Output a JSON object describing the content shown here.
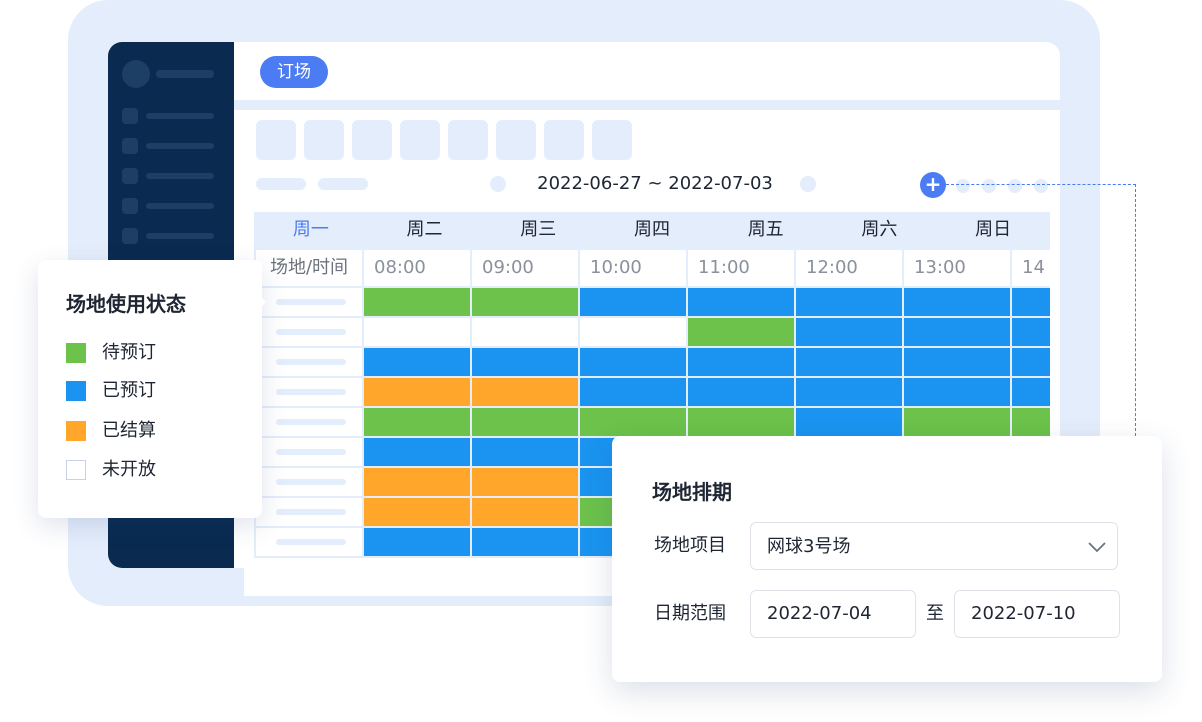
{
  "header": {
    "tab_label": "订场"
  },
  "date_range": "2022-06-27 ~ 2022-07-03",
  "add_icon": "+",
  "week_days": [
    "周一",
    "周二",
    "周三",
    "周四",
    "周五",
    "周六",
    "周日"
  ],
  "active_day_index": 0,
  "time_header": {
    "label": "场地/时间",
    "times": [
      "08:00",
      "09:00",
      "10:00",
      "11:00",
      "12:00",
      "13:00",
      "14"
    ]
  },
  "status_colors": {
    "pending": "#6cc24a",
    "booked": "#1a94f0",
    "settled": "#ffa62b",
    "closed": "#ffffff"
  },
  "schedule": [
    [
      "pending",
      "pending",
      "booked",
      "booked",
      "booked",
      "booked",
      "booked"
    ],
    [
      "closed",
      "closed",
      "closed",
      "pending",
      "booked",
      "booked",
      "booked"
    ],
    [
      "booked",
      "booked",
      "booked",
      "booked",
      "booked",
      "booked",
      "booked"
    ],
    [
      "settled",
      "settled",
      "booked",
      "booked",
      "booked",
      "booked",
      "booked"
    ],
    [
      "pending",
      "pending",
      "pending",
      "pending",
      "booked",
      "pending",
      "pending"
    ],
    [
      "booked",
      "booked",
      "booked",
      "booked",
      "booked",
      "booked",
      "booked"
    ],
    [
      "settled",
      "settled",
      "booked",
      "booked",
      "booked",
      "booked",
      "booked"
    ],
    [
      "settled",
      "settled",
      "pending",
      "booked",
      "booked",
      "booked",
      "booked"
    ],
    [
      "booked",
      "booked",
      "booked",
      "booked",
      "booked",
      "booked",
      "booked"
    ]
  ],
  "legend": {
    "title": "场地使用状态",
    "items": [
      {
        "label": "待预订",
        "status": "pending"
      },
      {
        "label": "已预订",
        "status": "booked"
      },
      {
        "label": "已结算",
        "status": "settled"
      },
      {
        "label": "未开放",
        "status": "closed"
      }
    ]
  },
  "dialog": {
    "title": "场地排期",
    "venue_label": "场地项目",
    "venue_value": "网球3号场",
    "date_label": "日期范围",
    "start_date": "2022-07-04",
    "range_separator": "至",
    "end_date": "2022-07-10"
  }
}
